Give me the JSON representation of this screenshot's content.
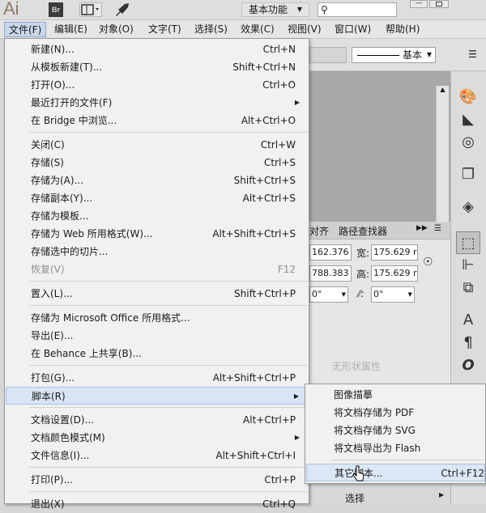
{
  "titlebar": {
    "app_logo": "Ai",
    "bridge_icon": "Br",
    "workspace_label": "基本功能",
    "search_placeholder": "",
    "icons": [
      "arrange-documents-icon",
      "gpu-rocket-icon",
      "search-icon",
      "minimize-icon",
      "maximize-icon"
    ]
  },
  "menubar": {
    "items": [
      "文件(F)",
      "编辑(E)",
      "对象(O)",
      "文字(T)",
      "选择(S)",
      "效果(C)",
      "视图(V)",
      "窗口(W)",
      "帮助(H)"
    ]
  },
  "control_bar": {
    "stroke_profile": "基本"
  },
  "panels": {
    "tab_align": "对齐",
    "tab_pathfinder": "路径查找器",
    "x_value": "162.376 r",
    "y_value": "788.383 r",
    "width_label": "宽:",
    "width_value": "175.629 r",
    "height_label": "高:",
    "height_value": "175.629 r",
    "rotate_value": "0°",
    "shear_value": "0°",
    "no_shape_text": "无形状属性",
    "bottom_select": "选择"
  },
  "file_menu": {
    "items": [
      {
        "label": "新建(N)...",
        "shortcut": "Ctrl+N"
      },
      {
        "label": "从模板新建(T)...",
        "shortcut": "Shift+Ctrl+N"
      },
      {
        "label": "打开(O)...",
        "shortcut": "Ctrl+O"
      },
      {
        "label": "最近打开的文件(F)",
        "shortcut": ""
      },
      {
        "label": "在 Bridge 中浏览...",
        "shortcut": "Alt+Ctrl+O"
      },
      {
        "label": "关闭(C)",
        "shortcut": "Ctrl+W"
      },
      {
        "label": "存储(S)",
        "shortcut": "Ctrl+S"
      },
      {
        "label": "存储为(A)...",
        "shortcut": "Shift+Ctrl+S"
      },
      {
        "label": "存储副本(Y)...",
        "shortcut": "Alt+Ctrl+S"
      },
      {
        "label": "存储为模板...",
        "shortcut": ""
      },
      {
        "label": "存储为 Web 所用格式(W)...",
        "shortcut": "Alt+Shift+Ctrl+S"
      },
      {
        "label": "存储选中的切片...",
        "shortcut": ""
      },
      {
        "label": "恢复(V)",
        "shortcut": "F12"
      },
      {
        "label": "置入(L)...",
        "shortcut": "Shift+Ctrl+P"
      },
      {
        "label": "存储为 Microsoft Office 所用格式...",
        "shortcut": ""
      },
      {
        "label": "导出(E)...",
        "shortcut": ""
      },
      {
        "label": "在 Behance 上共享(B)...",
        "shortcut": ""
      },
      {
        "label": "打包(G)...",
        "shortcut": "Alt+Shift+Ctrl+P"
      },
      {
        "label": "脚本(R)",
        "shortcut": ""
      },
      {
        "label": "文档设置(D)...",
        "shortcut": "Alt+Ctrl+P"
      },
      {
        "label": "文档颜色模式(M)",
        "shortcut": ""
      },
      {
        "label": "文件信息(I)...",
        "shortcut": "Alt+Shift+Ctrl+I"
      },
      {
        "label": "打印(P)...",
        "shortcut": "Ctrl+P"
      },
      {
        "label": "退出(X)",
        "shortcut": "Ctrl+Q"
      }
    ]
  },
  "script_menu": {
    "items": [
      {
        "label": "图像描摹",
        "shortcut": ""
      },
      {
        "label": "将文档存储为 PDF",
        "shortcut": ""
      },
      {
        "label": "将文档存储为 SVG",
        "shortcut": ""
      },
      {
        "label": "将文档导出为 Flash",
        "shortcut": ""
      },
      {
        "label": "其它脚本...",
        "shortcut": "Ctrl+F12"
      }
    ]
  },
  "colors": {
    "menu_bg": "#f1f1f1",
    "highlight": "#d8e5f5",
    "menubar_active": "#c9d7ea"
  }
}
